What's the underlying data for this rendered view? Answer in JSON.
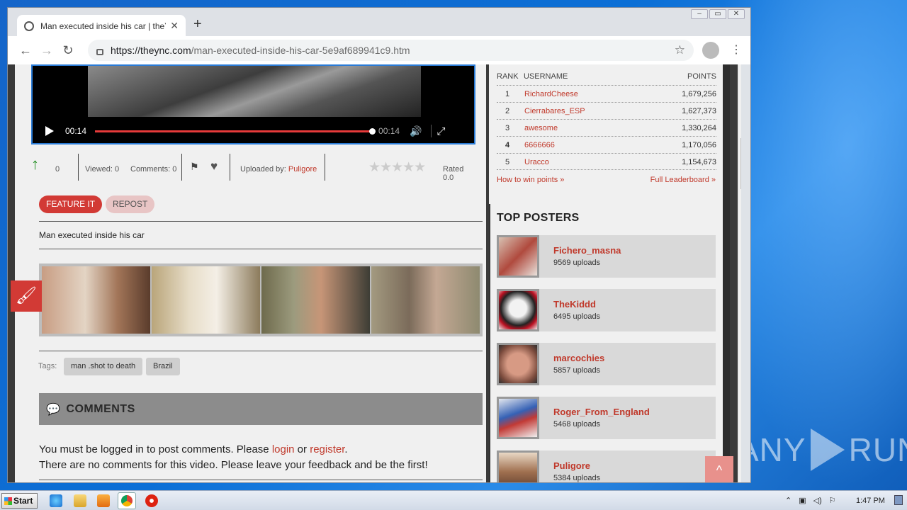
{
  "browser": {
    "tab_title": "Man executed inside his car | theYNC",
    "url_host": "https://theync.com",
    "url_path": "/man-executed-inside-his-car-5e9af689941c9.htm"
  },
  "video": {
    "current_time": "00:14",
    "duration": "00:14",
    "progress": 1.0
  },
  "stats": {
    "votes": "0",
    "viewed_label": "Viewed: 0",
    "comments_label": "Comments: 0",
    "uploaded_label": "Uploaded by: ",
    "uploader": "Puligore",
    "rating_stars": "★★★★★",
    "rated_label": "Rated 0.0"
  },
  "actions": {
    "feature": "FEATURE IT",
    "repost": "REPOST"
  },
  "video_title": "Man executed inside his car",
  "tags": {
    "label": "Tags:",
    "items": [
      "man .shot to death",
      "Brazil"
    ]
  },
  "comments": {
    "header": "COMMENTS",
    "line1_prefix": "You must be logged in to post comments. Please ",
    "login": "login",
    "or": " or ",
    "register": "register",
    "period": ".",
    "line2": "There are no comments for this video. Please leave your feedback and be the first!"
  },
  "leaderboard": {
    "headers": {
      "rank": "RANK",
      "username": "USERNAME",
      "points": "POINTS"
    },
    "rows": [
      {
        "rank": "1",
        "user": "RichardCheese",
        "points": "1,679,256"
      },
      {
        "rank": "2",
        "user": "Cierrabares_ESP",
        "points": "1,627,373"
      },
      {
        "rank": "3",
        "user": "awesome",
        "points": "1,330,264"
      },
      {
        "rank": "4",
        "user": "6666666",
        "points": "1,170,056"
      },
      {
        "rank": "5",
        "user": "Uracco",
        "points": "1,154,673"
      }
    ],
    "how_to": "How to win points »",
    "full": "Full Leaderboard »"
  },
  "top_posters": {
    "title": "TOP POSTERS",
    "items": [
      {
        "name": "Fichero_masna",
        "uploads": "9569 uploads"
      },
      {
        "name": "TheKiddd",
        "uploads": "6495 uploads"
      },
      {
        "name": "marcochies",
        "uploads": "5857 uploads"
      },
      {
        "name": "Roger_From_England",
        "uploads": "5468 uploads"
      },
      {
        "name": "Puligore",
        "uploads": "5384 uploads"
      }
    ]
  },
  "taskbar": {
    "start": "Start",
    "clock": "1:47 PM"
  },
  "watermark": "ANY RUN",
  "colors": {
    "accent": "#c0392b",
    "feature": "#d23a35",
    "desktop": "#1565c9"
  }
}
